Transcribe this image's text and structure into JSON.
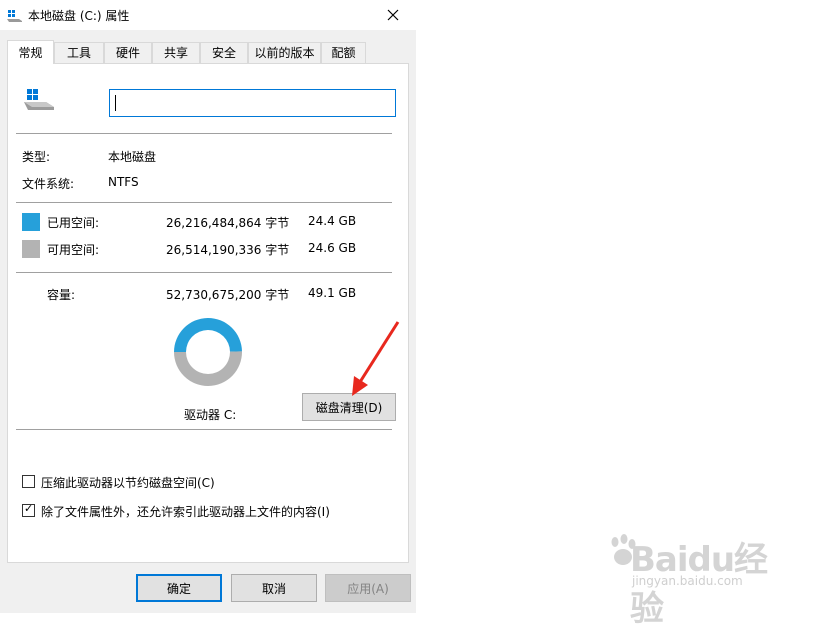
{
  "window": {
    "title": "本地磁盘 (C:) 属性"
  },
  "tabs": [
    {
      "label": "常规",
      "active": true
    },
    {
      "label": "工具"
    },
    {
      "label": "硬件"
    },
    {
      "label": "共享"
    },
    {
      "label": "安全"
    },
    {
      "label": "以前的版本"
    },
    {
      "label": "配额"
    }
  ],
  "general": {
    "volume_name_value": "",
    "type_label": "类型:",
    "type_value": "本地磁盘",
    "fs_label": "文件系统:",
    "fs_value": "NTFS",
    "used_label": "已用空间:",
    "used_bytes": "26,216,484,864 字节",
    "used_gb": "24.4 GB",
    "free_label": "可用空间:",
    "free_bytes": "26,514,190,336 字节",
    "free_gb": "24.6 GB",
    "capacity_label": "容量:",
    "capacity_bytes": "52,730,675,200 字节",
    "capacity_gb": "49.1 GB",
    "drive_label": "驱动器 C:",
    "cleanup_button": "磁盘清理(D)",
    "compress_label": "压缩此驱动器以节约磁盘空间(C)",
    "compress_checked": false,
    "index_label": "除了文件属性外，还允许索引此驱动器上文件的内容(I)",
    "index_checked": true,
    "used_fraction": 0.497,
    "used_color": "#26a0da",
    "free_color": "#b3b3b3"
  },
  "buttons": {
    "ok": "确定",
    "cancel": "取消",
    "apply": "应用(A)"
  },
  "annotation": {
    "arrow_color": "#e8281e"
  },
  "watermark": {
    "brand": "Baidu经验",
    "url": "jingyan.baidu.com"
  }
}
